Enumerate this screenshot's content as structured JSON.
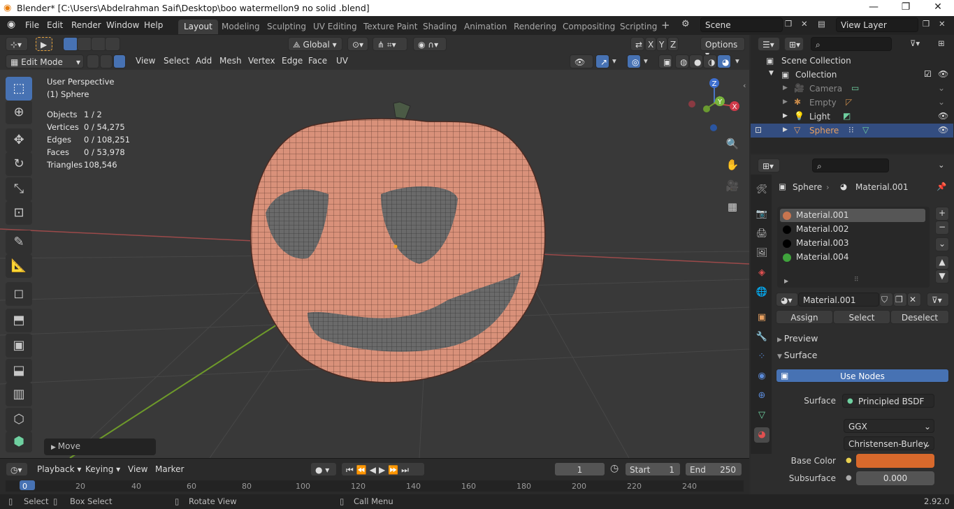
{
  "window": {
    "title": "Blender* [C:\\Users\\Abdelrahman Saif\\Desktop\\boo watermellon9 no solid .blend]",
    "min": "—",
    "max": "❐",
    "close": "✕"
  },
  "menus": [
    "File",
    "Edit",
    "Render",
    "Window",
    "Help"
  ],
  "workspaces": [
    "Layout",
    "Modeling",
    "Sculpting",
    "UV Editing",
    "Texture Paint",
    "Shading",
    "Animation",
    "Rendering",
    "Compositing",
    "Scripting"
  ],
  "scene": {
    "label": "Scene",
    "view_layer": "View Layer",
    "add": "+"
  },
  "header": {
    "mode": "Edit Mode",
    "menus": [
      "View",
      "Select",
      "Add",
      "Mesh",
      "Vertex",
      "Edge",
      "Face",
      "UV"
    ],
    "orientation": "Global",
    "options": "Options",
    "axes": [
      "X",
      "Y",
      "Z"
    ]
  },
  "overlay_text": {
    "view": "User Perspective",
    "object": "(1) Sphere",
    "stats": [
      {
        "label": "Objects",
        "value": "1 / 2"
      },
      {
        "label": "Vertices",
        "value": "0 / 54,275"
      },
      {
        "label": "Edges",
        "value": "0 / 108,251"
      },
      {
        "label": "Faces",
        "value": "0 / 53,978"
      },
      {
        "label": "Triangles",
        "value": "108,546"
      }
    ]
  },
  "gizmo": {
    "x": "X",
    "y": "Y",
    "z": "Z"
  },
  "last_op": "Move",
  "timeline": {
    "menus": [
      "Playback",
      "Keying",
      "View",
      "Marker"
    ],
    "current_frame": "1",
    "start_label": "Start",
    "start": "1",
    "end_label": "End",
    "end": "250",
    "ticks": [
      "0",
      "20",
      "40",
      "60",
      "80",
      "100",
      "120",
      "140",
      "160",
      "180",
      "200",
      "220",
      "240"
    ]
  },
  "status": {
    "select": "Select",
    "box_select": "Box Select",
    "rotate": "Rotate View",
    "call_menu": "Call Menu",
    "version": "2.92.0"
  },
  "outliner": {
    "root": "Scene Collection",
    "collection": "Collection",
    "items": [
      {
        "name": "Camera",
        "visible": false
      },
      {
        "name": "Empty",
        "visible": false
      },
      {
        "name": "Light",
        "visible": true
      },
      {
        "name": "Sphere",
        "visible": true,
        "selected": true
      }
    ]
  },
  "properties": {
    "object": "Sphere",
    "material": "Material.001",
    "slots": [
      {
        "name": "Material.001",
        "color": "#c8754f"
      },
      {
        "name": "Material.002",
        "color": "#000000"
      },
      {
        "name": "Material.003",
        "color": "#000000"
      },
      {
        "name": "Material.004",
        "color": "#3fa33c"
      }
    ],
    "active_material": "Material.001",
    "assign": "Assign",
    "select": "Select",
    "deselect": "Deselect",
    "preview": "Preview",
    "surface_section": "Surface",
    "use_nodes": "Use Nodes",
    "surface_label": "Surface",
    "surface_value": "Principled BSDF",
    "distribution": "GGX",
    "subsurface_method": "Christensen-Burley",
    "base_color_label": "Base Color",
    "base_color": "#d8692c",
    "subsurface_label": "Subsurface",
    "subsurface_value": "0.000"
  }
}
